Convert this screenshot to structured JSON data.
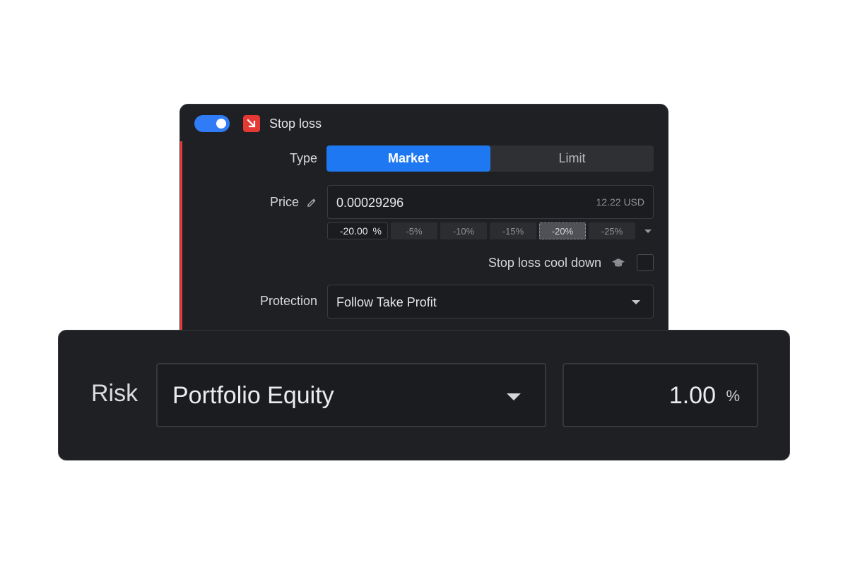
{
  "stop_loss": {
    "enabled": true,
    "title": "Stop loss",
    "type": {
      "label": "Type",
      "options": [
        "Market",
        "Limit"
      ],
      "selected": "Market"
    },
    "price": {
      "label": "Price",
      "value": "0.00029296",
      "secondary": "12.22 USD"
    },
    "percent": {
      "value": "-20.00",
      "unit": "%",
      "presets": [
        "-5%",
        "-10%",
        "-15%",
        "-20%",
        "-25%"
      ],
      "selected_preset": "-20%"
    },
    "cooldown": {
      "label": "Stop loss cool down",
      "checked": false
    },
    "protection": {
      "label": "Protection",
      "value": "Follow Take Profit"
    }
  },
  "risk": {
    "label": "Risk",
    "mode": "Portfolio Equity",
    "value": "1.00",
    "unit": "%"
  },
  "colors": {
    "accent_blue": "#1e78f2",
    "stop_red": "#e53935",
    "panel_bg": "#1f2023"
  },
  "icons": {
    "toggle": "toggle-switch",
    "stop_loss": "arrow-down-right-icon",
    "price_picker": "eyedropper-icon",
    "cooldown_help": "graduation-cap-icon",
    "dropdown": "caret-down-icon"
  }
}
